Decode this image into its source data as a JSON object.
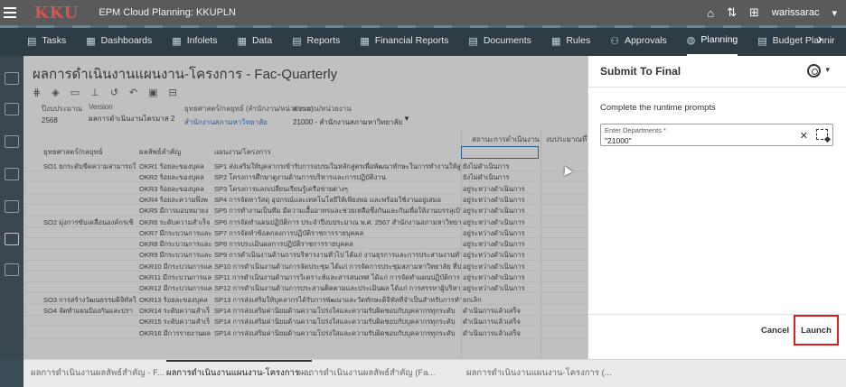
{
  "header": {
    "logo": "KKU",
    "app_title": "EPM Cloud Planning: KKUPLN",
    "user": "warissarac"
  },
  "nav": {
    "items": [
      {
        "label": "Tasks",
        "icon": "clipboard-icon"
      },
      {
        "label": "Dashboards",
        "icon": "grid-icon"
      },
      {
        "label": "Infolets",
        "icon": "grid-icon"
      },
      {
        "label": "Data",
        "icon": "grid-icon"
      },
      {
        "label": "Reports",
        "icon": "document-icon"
      },
      {
        "label": "Financial Reports",
        "icon": "grid-icon"
      },
      {
        "label": "Documents",
        "icon": "document-icon"
      },
      {
        "label": "Rules",
        "icon": "grid-icon"
      },
      {
        "label": "Approvals",
        "icon": "org-icon"
      },
      {
        "label": "Planning",
        "icon": "globe-icon",
        "active": true
      },
      {
        "label": "Budget Plannir",
        "icon": "document-icon"
      }
    ]
  },
  "main": {
    "title": "ผลการดำเนินงานแผนงาน-โครงการ - Fac-Quarterly",
    "pov": [
      {
        "label": "ปีงบประมาณ",
        "value": "2568"
      },
      {
        "label": "Version",
        "value": "ผลการดำเนินงานไตรมาส 2"
      },
      {
        "label": "ยุทธศาสตร์/กลยุทธ์ (สำนักงาน/หน่วยงาน)",
        "value": "สำนักงานสภามหาวิทยาลัย"
      },
      {
        "label": "ส่วนงาน/หน่วยงาน",
        "value": "21000 - สำนักงานสภามหาวิทยาลัย"
      }
    ],
    "columns": [
      "ยุทธศาสตร์/กลยุทธ์",
      "ผลลัพธ์สำคัญ",
      "แผนงาน/โครงการ",
      "สถานะการดำเนินงาน",
      "งบประมาณที่ไ"
    ],
    "rows": [
      {
        "s": "SO1 ยกระดับขีดความสามารถใ",
        "o": "OKR1 ร้อยละของบุคล",
        "p": "SP1 ส่งเสริมให้บุคลากรเข้ารับการอบรมในหลักสูตรเพื่อพัฒนาทักษะในการทำงานให้สูงขึ้",
        "st": "ยังไม่ดำเนินการ"
      },
      {
        "s": "",
        "o": "OKR2 ร้อยละของบุคล",
        "p": "SP2 โครงการศึกษาดูงานด้านการบริหารและการปฏิบัติงาน",
        "st": "ยังไม่ดำเนินการ"
      },
      {
        "s": "",
        "o": "OKR3 ร้อยละของบุคล",
        "p": "SP3 โครงการแลกเปลี่ยนเรียนรู้เครือข่ายต่างๆ",
        "st": "อยู่ระหว่างดำเนินการ"
      },
      {
        "s": "",
        "o": "OKR4 ร้อยละความพึงพ",
        "p": "SP4 การจัดหาวัสดุ อุปกรณ์และเทคโนโลยีให้เพียงพอ และพร้อมใช้งานอยู่เสมอ",
        "st": "อยู่ระหว่างดำเนินการ"
      },
      {
        "s": "",
        "o": "OKR5 มีการมอบหมายง",
        "p": "SP5 การทำงานเป็นทีม มีความเอื้ออาทรและช่วยเหลือซึ่งกันและกันเพื่อให้งานบรรลุเป้า",
        "st": "อยู่ระหว่างดำเนินการ"
      },
      {
        "s": "SO2 มุ่งการขับเคลื่อนองค์กรเชิ",
        "o": "OKR6 ระดับความสำเร็จ",
        "p": "SP6 การจัดทำแผนปฏิบัติการ ประจำปีงบประมาณ พ.ศ. 2567 สำนักงานสภามหาวิทยาลัย",
        "st": "อยู่ระหว่างดำเนินการ"
      },
      {
        "s": "",
        "o": "OKR7 มีกระบวนการและ",
        "p": "SP7 การจัดทำข้อตกลงการปฏิบัติราชการรายบุคคล",
        "st": "อยู่ระหว่างดำเนินการ"
      },
      {
        "s": "",
        "o": "OKR8 มีกระบวนการและ",
        "p": "SP8 การประเมินผลการปฏิบัติราชการรายบุคคล",
        "st": "อยู่ระหว่างดำเนินการ"
      },
      {
        "s": "",
        "o": "OKR9 มีกระบวนการและ",
        "p": "SP9 การดำเนินงานด้านการบริหารงานทั่วไป ได้แก่ งานธุรการและการประสานงานทั่วไป งาน",
        "st": "อยู่ระหว่างดำเนินการ"
      },
      {
        "s": "",
        "o": "OKR10 มีกระบวนการแล",
        "p": "SP10 การดำเนินงานด้านการจัดประชุม ได้แก่ การจัดการประชุมสภามหาวิทยาลัย ที่ประชุม",
        "st": "อยู่ระหว่างดำเนินการ"
      },
      {
        "s": "",
        "o": "OKR11 มีกระบวนการแล",
        "p": "SP11 การดำเนินงานด้านการวิเคราะห์และสารสนเทศ ได้แก่ การจัดทำแผนปฏิบัติการ การ",
        "st": "อยู่ระหว่างดำเนินการ"
      },
      {
        "s": "",
        "o": "OKR12 มีกระบวนการแล",
        "p": "SP12 การดำเนินงานด้านการประสานติดตามและประเมินผล ได้แก่ การสรรหาผู้บริหารที่อยู่",
        "st": "อยู่ระหว่างดำเนินการ"
      },
      {
        "s": "SO3 การสร้างวัฒนธรรมดิจิทัลใ",
        "o": "OKR13 ร้อยละของบุคล",
        "p": "SP13 การส่งเสริมให้บุคลากรได้รับการพัฒนาและวัดทักษะดิจิทัลที่จำเป็นสำหรับการทำงา",
        "st": "ยกเลิก"
      },
      {
        "s": "SO4 จัดทำแผนป้องกันและปรา",
        "o": "OKR14 ระดับความสำเร็",
        "p": "SP14 การส่งเสริมค่านิยมด้านความโปร่งใสและความรับผิดชอบกับบุคลากรทุกระดับ",
        "st": "ดำเนินการแล้วเสร็จ"
      },
      {
        "s": "",
        "o": "OKR15 ระดับความสำเร็",
        "p": "SP14 การส่งเสริมค่านิยมด้านความโปร่งใสและความรับผิดชอบกับบุคลากรทุกระดับ",
        "st": "ดำเนินการแล้วเสร็จ"
      },
      {
        "s": "",
        "o": "OKR16 มีการรายงานผล",
        "p": "SP14 การส่งเสริมค่านิยมด้านความโปร่งใสและความรับผิดชอบกับบุคลากรทุกระดับ",
        "st": "ดำเนินการแล้วเสร็จ"
      }
    ]
  },
  "bottom_tabs": [
    {
      "label": "ผลการดำเนินงานผลลัพธ์สำคัญ - F..."
    },
    {
      "label": "ผลการดำเนินงานแผนงาน-โครงการ -...",
      "active": true
    },
    {
      "label": "ผลการดำเนินงานผลลัพธ์สำคัญ (Fa..."
    },
    {
      "label": "ผลการดำเนินงานแผนงาน-โครงการ (..."
    }
  ],
  "dialog": {
    "title": "Submit To Final",
    "prompt_heading": "Complete the runtime prompts",
    "field_label": "Enter Departments",
    "required_mark": "*",
    "field_value": "\"21000\"",
    "clear_glyph": "✕",
    "cancel_label": "Cancel",
    "launch_label": "Launch"
  },
  "colors": {
    "nav_bg": "#2e3d45",
    "topbar_bg": "#5a5a5a",
    "launch_highlight": "#d62020",
    "link": "#2a6ebb"
  }
}
